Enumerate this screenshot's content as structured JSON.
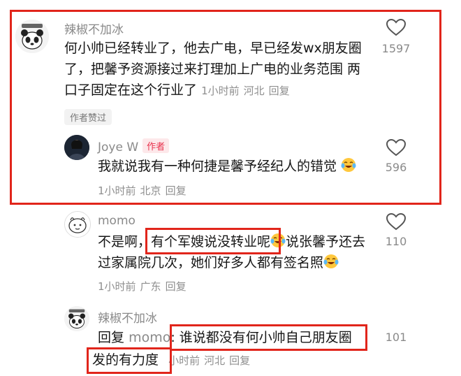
{
  "comments": {
    "c1": {
      "author": "辣椒不加冰",
      "text": "何小帅已经转业了，他去广电，早已经发wx朋友圈了，把馨予资源接过来打理加上广电的业务范围 两口子固定在这个行业了",
      "time": "1小时前",
      "location": "河北",
      "reply_label": "回复",
      "likes": "1597",
      "tag": "作者赞过"
    },
    "r1": {
      "author": "Joye W",
      "badge": "作者",
      "text": "我就说我有一种何捷是馨予经纪人的错觉",
      "time": "1小时前",
      "location": "北京",
      "reply_label": "回复",
      "likes": "596"
    },
    "r2": {
      "author": "momo",
      "text_a": "不是啊，",
      "text_b": "有个军嫂说没转业呢",
      "text_c": "说张馨予还去过家属院几次，她们好多人都有签名照",
      "time": "1小时前",
      "location": "广东",
      "reply_label": "回复",
      "likes": "110"
    },
    "r3": {
      "author": "辣椒不加冰",
      "prefix": "回复",
      "mention": "momo",
      "colon": ":",
      "text_a": "谁说都没有何小帅自己朋友圈",
      "text_b": "发的有力度",
      "time": "小时前",
      "location": "河北",
      "reply_label": "回复",
      "likes": "101"
    }
  },
  "colors": {
    "highlight_box": "#e1251b",
    "author_badge": "#e8324d"
  },
  "icons": [
    "heart-outline-icon",
    "crying-laughing-emoji"
  ]
}
